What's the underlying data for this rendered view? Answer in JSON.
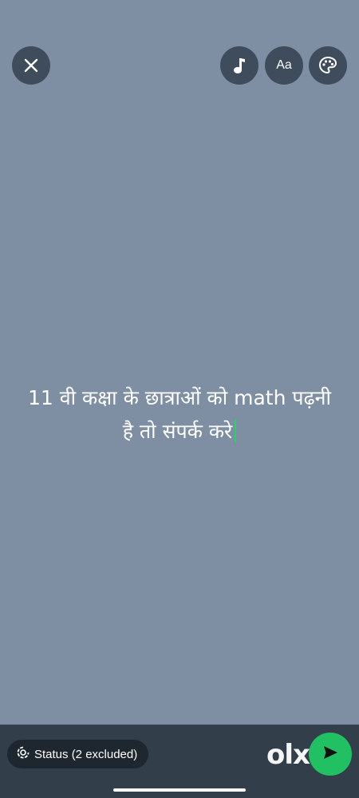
{
  "toolbar": {
    "close_icon": "close-icon",
    "music_icon": "music-note-icon",
    "font_button_label": "Aa",
    "palette_icon": "palette-icon"
  },
  "status": {
    "text_line1": "11 वी कक्षा के छात्राओं को math पढ़नी",
    "text_line2": "है तो संपर्क करे",
    "background_color": "#7e8fa4",
    "caret_color": "#25d366"
  },
  "bottom": {
    "audience_label": "Status (2 excluded)",
    "audience_icon": "status-ring-icon",
    "send_icon": "send-icon",
    "send_color": "#21c063",
    "watermark": "olx"
  }
}
